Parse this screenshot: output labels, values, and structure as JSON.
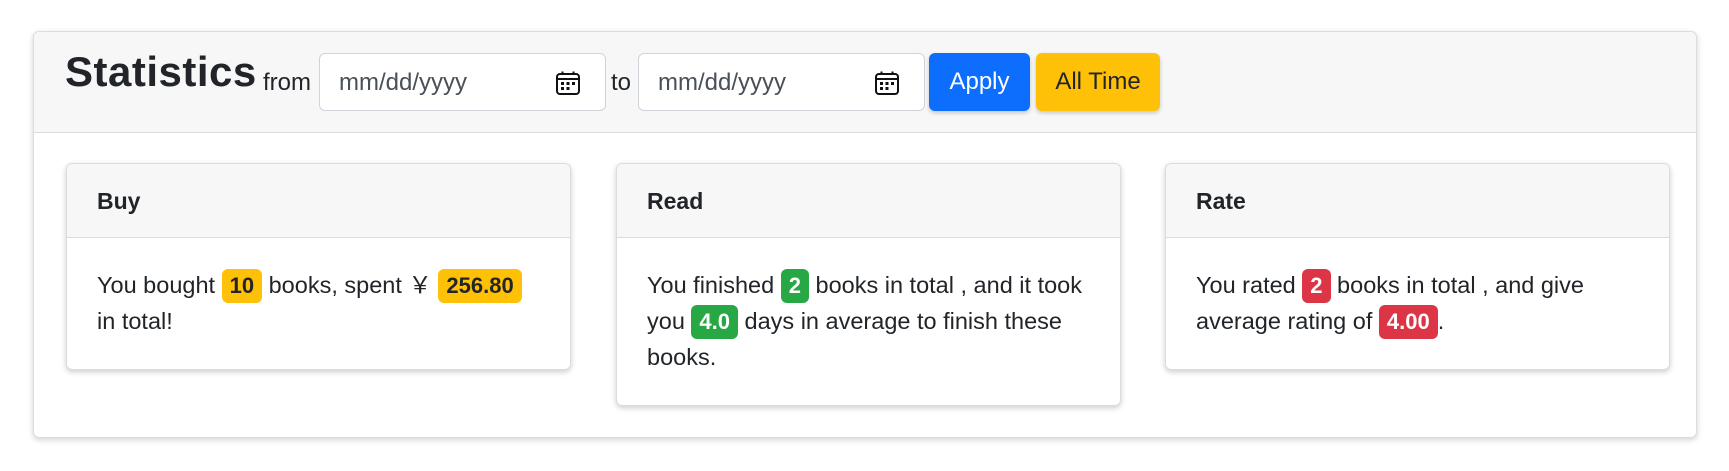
{
  "header": {
    "title": "Statistics",
    "from_label": "from",
    "to_label": "to",
    "date_from": {
      "value": "",
      "placeholder": "mm/dd/yyyy"
    },
    "date_to": {
      "value": "",
      "placeholder": "mm/dd/yyyy"
    },
    "apply_label": "Apply",
    "all_time_label": "All Time"
  },
  "cards": {
    "buy": {
      "title": "Buy",
      "text_1": "You bought ",
      "count": "10",
      "text_2": " books, spent ￥ ",
      "amount": "256.80",
      "text_3": " in total!"
    },
    "read": {
      "title": "Read",
      "text_1": "You finished ",
      "count": "2",
      "text_2": " books in total , and it took you ",
      "days": "4.0",
      "text_3": " days in average to finish these books."
    },
    "rate": {
      "title": "Rate",
      "text_1": "You rated ",
      "count": "2",
      "text_2": " books in total , and give average rating of ",
      "rating": "4.00",
      "text_3": "."
    }
  },
  "colors": {
    "primary": "#0d6efd",
    "warning": "#ffc107",
    "success": "#28a745",
    "danger": "#dc3545"
  },
  "icons": {
    "date_picker": "calendar-icon"
  }
}
